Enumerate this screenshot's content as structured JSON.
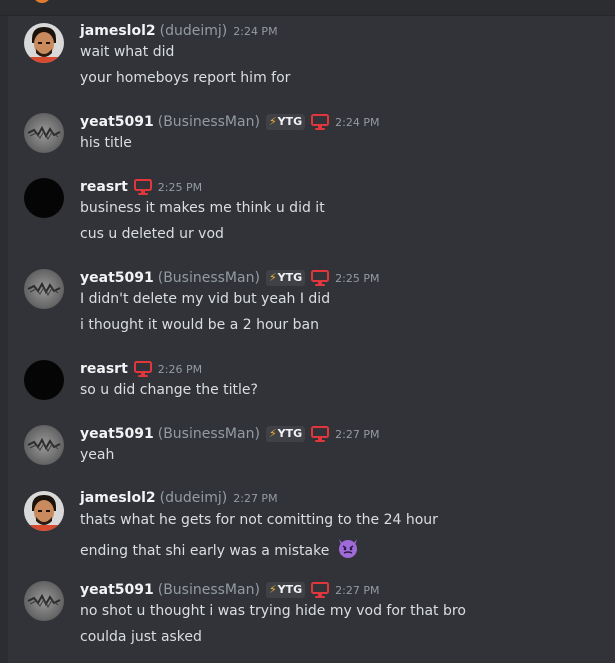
{
  "users": {
    "james": {
      "name": "jameslol2",
      "alias": "(dudeimj)"
    },
    "yeat": {
      "name": "yeat5091",
      "alias": "(BusinessMan)",
      "tag": "YTG"
    },
    "reasrt": {
      "name": "reasrt"
    }
  },
  "messages": [
    {
      "time": "2:24 PM",
      "lines": [
        "wait what did",
        "your homeboys report him for"
      ]
    },
    {
      "time": "2:24 PM",
      "lines": [
        "his title"
      ]
    },
    {
      "time": "2:25 PM",
      "lines": [
        "business it makes me think u did it",
        "cus u deleted ur vod"
      ]
    },
    {
      "time": "2:25 PM",
      "lines": [
        "I didn't delete my vid but yeah I did",
        "i thought it would be a 2 hour ban"
      ]
    },
    {
      "time": "2:26 PM",
      "lines": [
        "so u did change the title?"
      ]
    },
    {
      "time": "2:27 PM",
      "lines": [
        "yeah"
      ]
    },
    {
      "time": "2:27 PM",
      "lines": [
        "thats what he gets for not comitting to the 24 hour",
        "ending that shi early was a mistake"
      ]
    },
    {
      "time": "2:27 PM",
      "lines": [
        "no shot u thought i was trying hide my vod for that bro",
        "coulda just asked"
      ]
    }
  ],
  "icons": {
    "monitor": "monitor-icon",
    "bolt": "lightning-bolt-icon",
    "emoji": "smiling-imp-emoji"
  },
  "colors": {
    "background": "#313338",
    "monitor_red": "#e0363c",
    "bolt_yellow": "#f0b232"
  }
}
